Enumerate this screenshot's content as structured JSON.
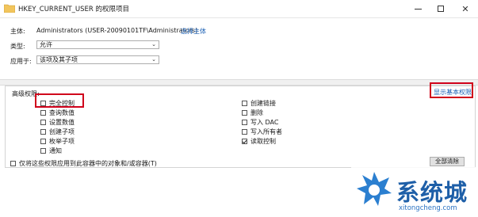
{
  "window": {
    "title": "HKEY_CURRENT_USER 的权限项目",
    "minimize_label": "—",
    "maximize_label": "□",
    "close_label": "✕"
  },
  "principal": {
    "label": "主体:",
    "value": "Administrators (USER-20090101TF\\Administrators)",
    "select_link": "选择主体"
  },
  "type": {
    "label": "类型:",
    "value": "允许"
  },
  "applies_to": {
    "label": "应用于:",
    "value": "该项及其子项"
  },
  "advanced": {
    "title": "高级权限:",
    "show_basic_link": "显示基本权限",
    "left_items": [
      {
        "label": "完全控制",
        "checked": false
      },
      {
        "label": "查询数值",
        "checked": false
      },
      {
        "label": "设置数值",
        "checked": false
      },
      {
        "label": "创建子项",
        "checked": false
      },
      {
        "label": "枚举子项",
        "checked": false
      },
      {
        "label": "通知",
        "checked": false
      }
    ],
    "right_items": [
      {
        "label": "创建链接",
        "checked": false
      },
      {
        "label": "删除",
        "checked": false
      },
      {
        "label": "写入 DAC",
        "checked": false
      },
      {
        "label": "写入所有者",
        "checked": false
      },
      {
        "label": "读取控制",
        "checked": true
      }
    ],
    "apply_only_label": "仅将这些权限应用到此容器中的对象和/或容器(T)",
    "clear_all_button": "全部清除"
  },
  "watermark": {
    "brand": "系统城",
    "url": "xitongcheng.com"
  },
  "colors": {
    "highlight": "#d0021b",
    "link": "#1a5fb4",
    "brand": "#1e5fa8"
  }
}
